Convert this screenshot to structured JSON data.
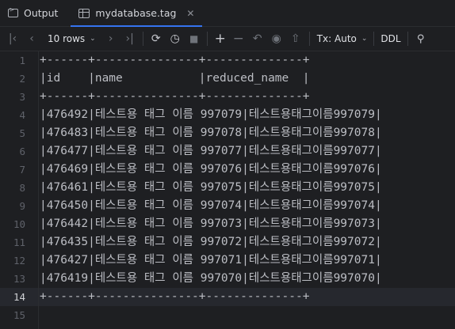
{
  "tabs": [
    {
      "label": "Output",
      "icon": "terminal-icon",
      "active": false
    },
    {
      "label": "mydatabase.tag",
      "icon": "table-icon",
      "active": true
    }
  ],
  "toolbar": {
    "rows_label": "10 rows",
    "tx_label": "Tx: Auto",
    "ddl_label": "DDL"
  },
  "editor": {
    "line_numbers": [
      "1",
      "2",
      "3",
      "4",
      "5",
      "6",
      "7",
      "8",
      "9",
      "10",
      "11",
      "12",
      "13",
      "14",
      "15"
    ],
    "current_line": "14",
    "lines": [
      "+------+---------------+--------------+",
      "|id    |name           |reduced_name  |",
      "+------+---------------+--------------+",
      "|476492|테스트용 태그 이름 997079|테스트용태그이름997079|",
      "|476483|테스트용 태그 이름 997078|테스트용태그이름997078|",
      "|476477|테스트용 태그 이름 997077|테스트용태그이름997077|",
      "|476469|테스트용 태그 이름 997076|테스트용태그이름997076|",
      "|476461|테스트용 태그 이름 997075|테스트용태그이름997075|",
      "|476450|테스트용 태그 이름 997074|테스트용태그이름997074|",
      "|476442|테스트용 태그 이름 997073|테스트용태그이름997073|",
      "|476435|테스트용 태그 이름 997072|테스트용태그이름997072|",
      "|476427|테스트용 태그 이름 997071|테스트용태그이름997071|",
      "|476419|테스트용 태그 이름 997070|테스트용태그이름997070|",
      "+------+---------------+--------------+",
      ""
    ]
  }
}
